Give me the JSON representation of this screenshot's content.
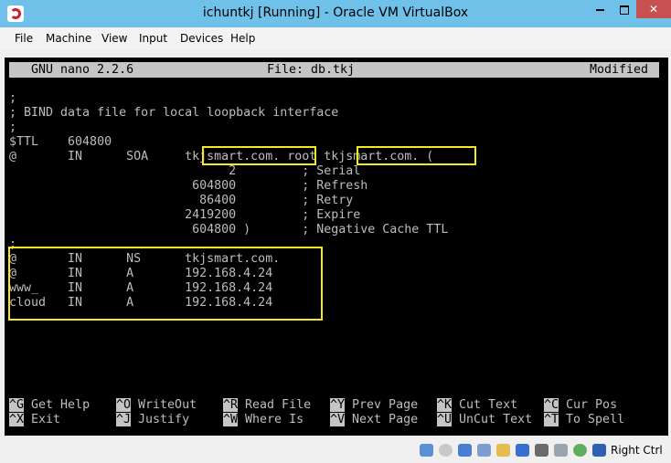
{
  "window": {
    "title": "ichuntkj [Running] - Oracle VM VirtualBox",
    "menu": [
      "File",
      "Machine",
      "View",
      "Input",
      "Devices",
      "Help"
    ]
  },
  "nano": {
    "status_left": "GNU nano 2.2.6",
    "status_center": "File: db.tkj",
    "status_right": "Modified",
    "lines": [
      ";",
      "; BIND data file for local loopback interface",
      ";",
      "$TTL    604800",
      "@       IN      SOA     tkjsmart.com. root tkjsmart.com. (",
      "                              2         ; Serial",
      "                         604800         ; Refresh",
      "                          86400         ; Retry",
      "                        2419200         ; Expire",
      "                         604800 )       ; Negative Cache TTL",
      ";",
      "@       IN      NS      tkjsmart.com.",
      "@       IN      A       192.168.4.24",
      "www_    IN      A       192.168.4.24",
      "cloud   IN      A       192.168.4.24"
    ],
    "shortcuts": [
      {
        "key": "^G",
        "label": "Get Help"
      },
      {
        "key": "^O",
        "label": "WriteOut"
      },
      {
        "key": "^R",
        "label": "Read File"
      },
      {
        "key": "^Y",
        "label": "Prev Page"
      },
      {
        "key": "^K",
        "label": "Cut Text"
      },
      {
        "key": "^C",
        "label": "Cur Pos"
      },
      {
        "key": "^X",
        "label": "Exit"
      },
      {
        "key": "^J",
        "label": "Justify"
      },
      {
        "key": "^W",
        "label": "Where Is"
      },
      {
        "key": "^V",
        "label": "Next Page"
      },
      {
        "key": "^U",
        "label": "UnCut Text"
      },
      {
        "key": "^T",
        "label": "To Spell"
      }
    ]
  },
  "statusbar": {
    "host_key": "Right Ctrl",
    "icons": [
      "hard-disk-icon",
      "optical-drive-icon",
      "network-icon",
      "usb-icon",
      "shared-folders-icon",
      "display-icon",
      "video-capture-icon",
      "mouse-integration-icon",
      "cpu-icon",
      "keyboard-icon"
    ]
  },
  "colors": {
    "titlebar": "#6fc1e9",
    "highlight": "#f5ea1e",
    "terminal_bg": "#000000",
    "terminal_fg": "#bdbdbd"
  }
}
